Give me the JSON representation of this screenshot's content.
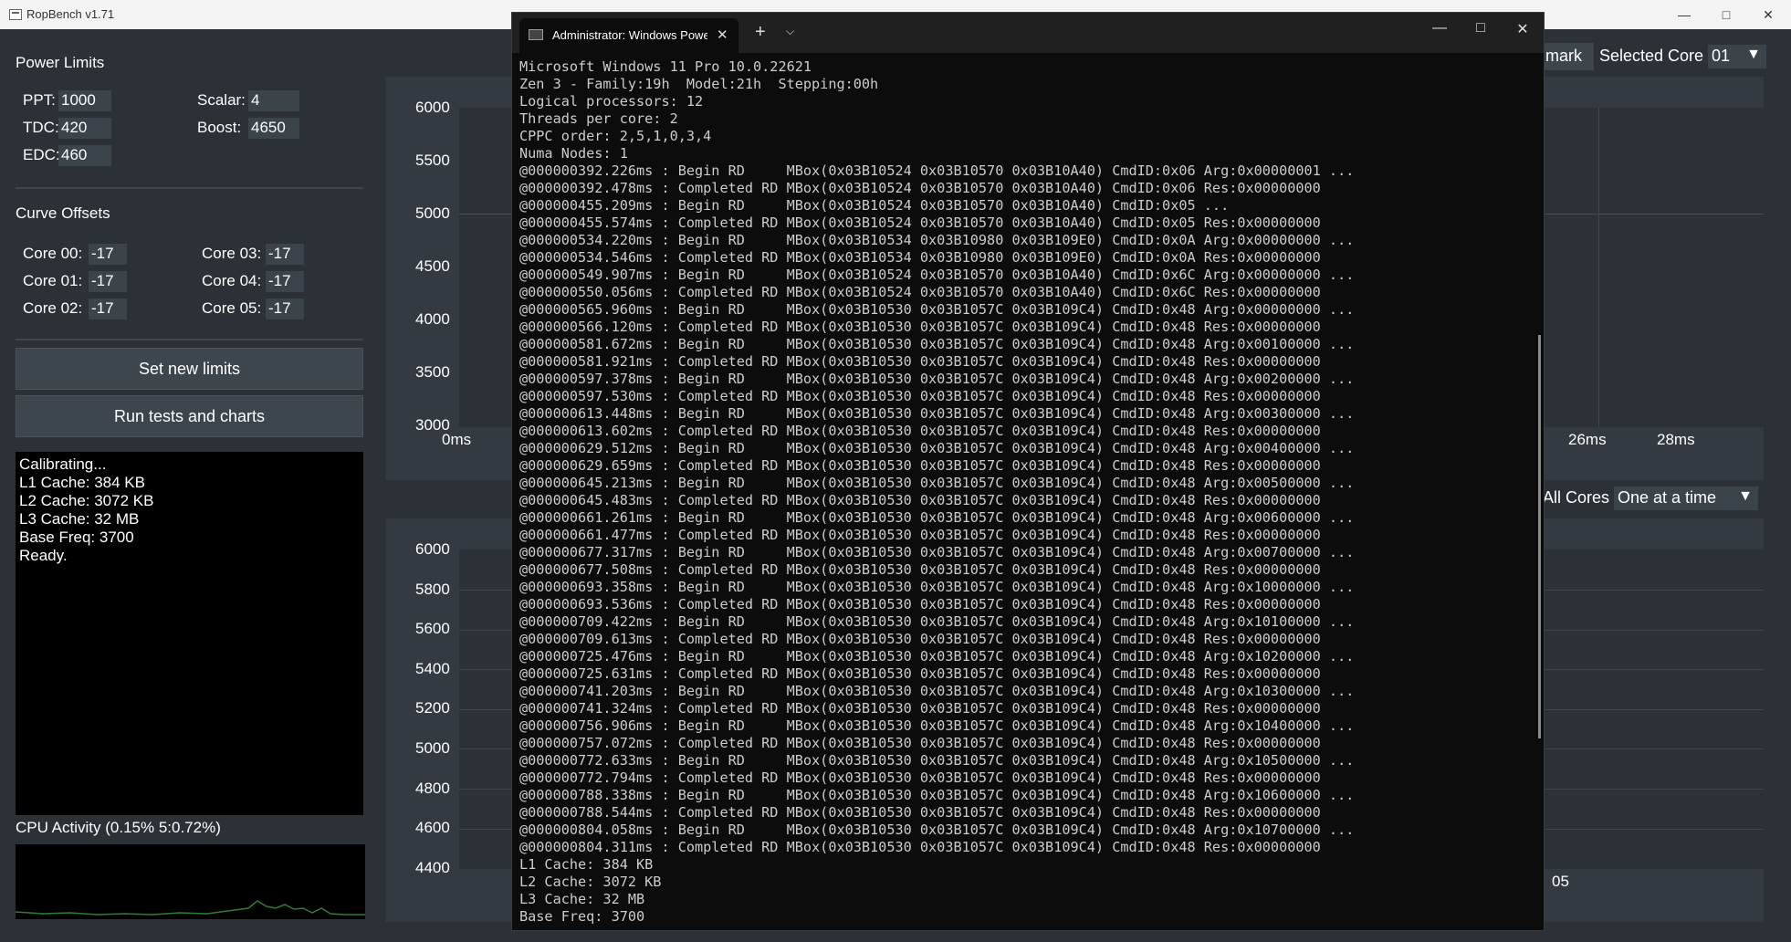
{
  "app": {
    "title": "RopBench v1.71"
  },
  "power_limits": {
    "title": "Power Limits",
    "ppt": {
      "label": "PPT:",
      "value": "1000"
    },
    "tdc": {
      "label": "TDC:",
      "value": "420"
    },
    "edc": {
      "label": "EDC:",
      "value": "460"
    },
    "scalar": {
      "label": "Scalar:",
      "value": "4"
    },
    "boost": {
      "label": "Boost:",
      "value": "4650"
    }
  },
  "curve_offsets": {
    "title": "Curve Offsets",
    "cores": [
      {
        "label": "Core 00:",
        "value": "-17"
      },
      {
        "label": "Core 01:",
        "value": "-17"
      },
      {
        "label": "Core 02:",
        "value": "-17"
      },
      {
        "label": "Core 03:",
        "value": "-17"
      },
      {
        "label": "Core 04:",
        "value": "-17"
      },
      {
        "label": "Core 05:",
        "value": "-17"
      }
    ]
  },
  "buttons": {
    "set_limits": "Set new limits",
    "run_tests": "Run tests and charts",
    "benchmark_partial": "mark"
  },
  "status_log": [
    "Calibrating...",
    "L1 Cache: 384 KB",
    "L2 Cache: 3072 KB",
    "L3 Cache: 32 MB",
    "Base Freq: 3700",
    "Ready."
  ],
  "cpu_activity": {
    "label": "CPU Activity (0.15% 5:0.72%)"
  },
  "selectors": {
    "selected_core": {
      "label": "Selected Core",
      "value": "01"
    },
    "all_cores": {
      "label": "All Cores",
      "value": "One at a time"
    }
  },
  "chart_data": [
    {
      "type": "line",
      "title": "",
      "y_ticks": [
        "6000",
        "5500",
        "5000",
        "4500",
        "4000",
        "3500",
        "3000"
      ],
      "ylim": [
        3000,
        6000
      ],
      "x_ticks": [
        "0ms",
        "26ms",
        "28ms"
      ],
      "series": []
    },
    {
      "type": "line",
      "title": "",
      "y_ticks": [
        "6000",
        "5800",
        "5600",
        "5400",
        "5200",
        "5000",
        "4800",
        "4600",
        "4400"
      ],
      "ylim": [
        4400,
        6000
      ],
      "x_ticks": [
        "05"
      ],
      "series": []
    }
  ],
  "terminal": {
    "tab_title": "Administrator: Windows PowerShell",
    "lines": [
      "Microsoft Windows 11 Pro 10.0.22621",
      "Zen 3 - Family:19h  Model:21h  Stepping:00h",
      "Logical processors: 12",
      "Threads per core: 2",
      "CPPC order: 2,5,1,0,3,4",
      "Numa Nodes: 1",
      "@000000392.226ms : Begin RD     MBox(0x03B10524 0x03B10570 0x03B10A40) CmdID:0x06 Arg:0x00000001 ...",
      "@000000392.478ms : Completed RD MBox(0x03B10524 0x03B10570 0x03B10A40) CmdID:0x06 Res:0x00000000",
      "@000000455.209ms : Begin RD     MBox(0x03B10524 0x03B10570 0x03B10A40) CmdID:0x05 ...",
      "@000000455.574ms : Completed RD MBox(0x03B10524 0x03B10570 0x03B10A40) CmdID:0x05 Res:0x00000000",
      "@000000534.220ms : Begin RD     MBox(0x03B10534 0x03B10980 0x03B109E0) CmdID:0x0A Arg:0x00000000 ...",
      "@000000534.546ms : Completed RD MBox(0x03B10534 0x03B10980 0x03B109E0) CmdID:0x0A Res:0x00000000",
      "@000000549.907ms : Begin RD     MBox(0x03B10524 0x03B10570 0x03B10A40) CmdID:0x6C Arg:0x00000000 ...",
      "@000000550.056ms : Completed RD MBox(0x03B10524 0x03B10570 0x03B10A40) CmdID:0x6C Res:0x00000000",
      "@000000565.960ms : Begin RD     MBox(0x03B10530 0x03B1057C 0x03B109C4) CmdID:0x48 Arg:0x00000000 ...",
      "@000000566.120ms : Completed RD MBox(0x03B10530 0x03B1057C 0x03B109C4) CmdID:0x48 Res:0x00000000",
      "@000000581.672ms : Begin RD     MBox(0x03B10530 0x03B1057C 0x03B109C4) CmdID:0x48 Arg:0x00100000 ...",
      "@000000581.921ms : Completed RD MBox(0x03B10530 0x03B1057C 0x03B109C4) CmdID:0x48 Res:0x00000000",
      "@000000597.378ms : Begin RD     MBox(0x03B10530 0x03B1057C 0x03B109C4) CmdID:0x48 Arg:0x00200000 ...",
      "@000000597.530ms : Completed RD MBox(0x03B10530 0x03B1057C 0x03B109C4) CmdID:0x48 Res:0x00000000",
      "@000000613.448ms : Begin RD     MBox(0x03B10530 0x03B1057C 0x03B109C4) CmdID:0x48 Arg:0x00300000 ...",
      "@000000613.602ms : Completed RD MBox(0x03B10530 0x03B1057C 0x03B109C4) CmdID:0x48 Res:0x00000000",
      "@000000629.512ms : Begin RD     MBox(0x03B10530 0x03B1057C 0x03B109C4) CmdID:0x48 Arg:0x00400000 ...",
      "@000000629.659ms : Completed RD MBox(0x03B10530 0x03B1057C 0x03B109C4) CmdID:0x48 Res:0x00000000",
      "@000000645.213ms : Begin RD     MBox(0x03B10530 0x03B1057C 0x03B109C4) CmdID:0x48 Arg:0x00500000 ...",
      "@000000645.483ms : Completed RD MBox(0x03B10530 0x03B1057C 0x03B109C4) CmdID:0x48 Res:0x00000000",
      "@000000661.261ms : Begin RD     MBox(0x03B10530 0x03B1057C 0x03B109C4) CmdID:0x48 Arg:0x00600000 ...",
      "@000000661.477ms : Completed RD MBox(0x03B10530 0x03B1057C 0x03B109C4) CmdID:0x48 Res:0x00000000",
      "@000000677.317ms : Begin RD     MBox(0x03B10530 0x03B1057C 0x03B109C4) CmdID:0x48 Arg:0x00700000 ...",
      "@000000677.508ms : Completed RD MBox(0x03B10530 0x03B1057C 0x03B109C4) CmdID:0x48 Res:0x00000000",
      "@000000693.358ms : Begin RD     MBox(0x03B10530 0x03B1057C 0x03B109C4) CmdID:0x48 Arg:0x10000000 ...",
      "@000000693.536ms : Completed RD MBox(0x03B10530 0x03B1057C 0x03B109C4) CmdID:0x48 Res:0x00000000",
      "@000000709.422ms : Begin RD     MBox(0x03B10530 0x03B1057C 0x03B109C4) CmdID:0x48 Arg:0x10100000 ...",
      "@000000709.613ms : Completed RD MBox(0x03B10530 0x03B1057C 0x03B109C4) CmdID:0x48 Res:0x00000000",
      "@000000725.476ms : Begin RD     MBox(0x03B10530 0x03B1057C 0x03B109C4) CmdID:0x48 Arg:0x10200000 ...",
      "@000000725.631ms : Completed RD MBox(0x03B10530 0x03B1057C 0x03B109C4) CmdID:0x48 Res:0x00000000",
      "@000000741.203ms : Begin RD     MBox(0x03B10530 0x03B1057C 0x03B109C4) CmdID:0x48 Arg:0x10300000 ...",
      "@000000741.324ms : Completed RD MBox(0x03B10530 0x03B1057C 0x03B109C4) CmdID:0x48 Res:0x00000000",
      "@000000756.906ms : Begin RD     MBox(0x03B10530 0x03B1057C 0x03B109C4) CmdID:0x48 Arg:0x10400000 ...",
      "@000000757.072ms : Completed RD MBox(0x03B10530 0x03B1057C 0x03B109C4) CmdID:0x48 Res:0x00000000",
      "@000000772.633ms : Begin RD     MBox(0x03B10530 0x03B1057C 0x03B109C4) CmdID:0x48 Arg:0x10500000 ...",
      "@000000772.794ms : Completed RD MBox(0x03B10530 0x03B1057C 0x03B109C4) CmdID:0x48 Res:0x00000000",
      "@000000788.338ms : Begin RD     MBox(0x03B10530 0x03B1057C 0x03B109C4) CmdID:0x48 Arg:0x10600000 ...",
      "@000000788.544ms : Completed RD MBox(0x03B10530 0x03B1057C 0x03B109C4) CmdID:0x48 Res:0x00000000",
      "@000000804.058ms : Begin RD     MBox(0x03B10530 0x03B1057C 0x03B109C4) CmdID:0x48 Arg:0x10700000 ...",
      "@000000804.311ms : Completed RD MBox(0x03B10530 0x03B1057C 0x03B109C4) CmdID:0x48 Res:0x00000000",
      "L1 Cache: 384 KB",
      "L2 Cache: 3072 KB",
      "L3 Cache: 32 MB",
      "Base Freq: 3700"
    ]
  }
}
